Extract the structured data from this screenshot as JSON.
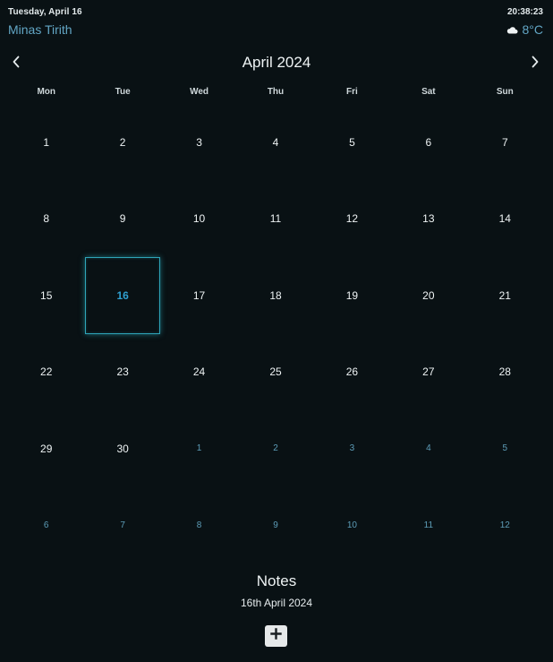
{
  "header": {
    "date_label": "Tuesday, April 16",
    "time_label": "20:38:23",
    "city": "Minas Tirith",
    "weather": {
      "icon": "cloud-icon",
      "temperature": "8°C"
    }
  },
  "calendar": {
    "month_title": "April 2024",
    "weekdays": [
      "Mon",
      "Tue",
      "Wed",
      "Thu",
      "Fri",
      "Sat",
      "Sun"
    ],
    "weeks": [
      [
        {
          "d": "1",
          "o": false
        },
        {
          "d": "2",
          "o": false
        },
        {
          "d": "3",
          "o": false
        },
        {
          "d": "4",
          "o": false
        },
        {
          "d": "5",
          "o": false
        },
        {
          "d": "6",
          "o": false
        },
        {
          "d": "7",
          "o": false
        }
      ],
      [
        {
          "d": "8",
          "o": false
        },
        {
          "d": "9",
          "o": false
        },
        {
          "d": "10",
          "o": false
        },
        {
          "d": "11",
          "o": false
        },
        {
          "d": "12",
          "o": false
        },
        {
          "d": "13",
          "o": false
        },
        {
          "d": "14",
          "o": false
        }
      ],
      [
        {
          "d": "15",
          "o": false
        },
        {
          "d": "16",
          "o": false,
          "today": true
        },
        {
          "d": "17",
          "o": false
        },
        {
          "d": "18",
          "o": false
        },
        {
          "d": "19",
          "o": false
        },
        {
          "d": "20",
          "o": false
        },
        {
          "d": "21",
          "o": false
        }
      ],
      [
        {
          "d": "22",
          "o": false
        },
        {
          "d": "23",
          "o": false
        },
        {
          "d": "24",
          "o": false
        },
        {
          "d": "25",
          "o": false
        },
        {
          "d": "26",
          "o": false
        },
        {
          "d": "27",
          "o": false
        },
        {
          "d": "28",
          "o": false
        }
      ],
      [
        {
          "d": "29",
          "o": false
        },
        {
          "d": "30",
          "o": false
        },
        {
          "d": "1",
          "o": true
        },
        {
          "d": "2",
          "o": true
        },
        {
          "d": "3",
          "o": true
        },
        {
          "d": "4",
          "o": true
        },
        {
          "d": "5",
          "o": true
        }
      ],
      [
        {
          "d": "6",
          "o": true
        },
        {
          "d": "7",
          "o": true
        },
        {
          "d": "8",
          "o": true
        },
        {
          "d": "9",
          "o": true
        },
        {
          "d": "10",
          "o": true
        },
        {
          "d": "11",
          "o": true
        },
        {
          "d": "12",
          "o": true
        }
      ]
    ],
    "nav": {
      "prev_icon": "chevron-left-icon",
      "next_icon": "chevron-right-icon"
    }
  },
  "notes": {
    "title": "Notes",
    "date": "16th April 2024",
    "add_icon": "plus-icon"
  },
  "colors": {
    "background": "#091114",
    "accent": "#62a6c5",
    "today_border": "#2ea4b8"
  }
}
